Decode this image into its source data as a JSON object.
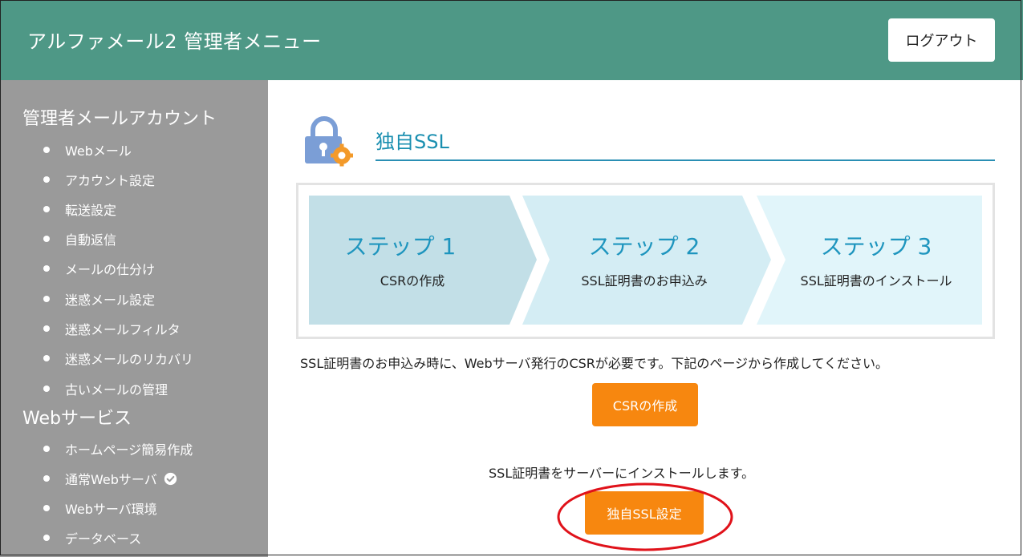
{
  "header": {
    "title": "アルファメール2 管理者メニュー",
    "logout_label": "ログアウト"
  },
  "sidebar": {
    "sections": [
      {
        "heading": "管理者メールアカウント",
        "items": [
          "Webメール",
          "アカウント設定",
          "転送設定",
          "自動返信",
          "メールの仕分け",
          "迷惑メール設定",
          "迷惑メールフィルタ",
          "迷惑メールのリカバリ",
          "古いメールの管理"
        ]
      },
      {
        "heading": "Webサービス",
        "items": [
          "ホームページ簡易作成",
          "通常Webサーバ",
          "Webサーバ環境",
          "データベース"
        ]
      }
    ]
  },
  "main": {
    "title": "独自SSL",
    "steps": [
      {
        "label": "ステップ 1",
        "sub": "CSRの作成"
      },
      {
        "label": "ステップ 2",
        "sub": "SSL証明書のお申込み"
      },
      {
        "label": "ステップ 3",
        "sub": "SSL証明書のインストール"
      }
    ],
    "csr_info": "SSL証明書のお申込み時に、Webサーバ発行のCSRが必要です。下記のページから作成してください。",
    "csr_button": "CSRの作成",
    "install_info": "SSL証明書をサーバーにインストールします。",
    "ssl_button": "独自SSL設定"
  },
  "colors": {
    "header": "#4e9886",
    "sidebar": "#9a9a9a",
    "accent": "#1e95be",
    "button": "#f7870f",
    "highlight": "#e0121a"
  }
}
